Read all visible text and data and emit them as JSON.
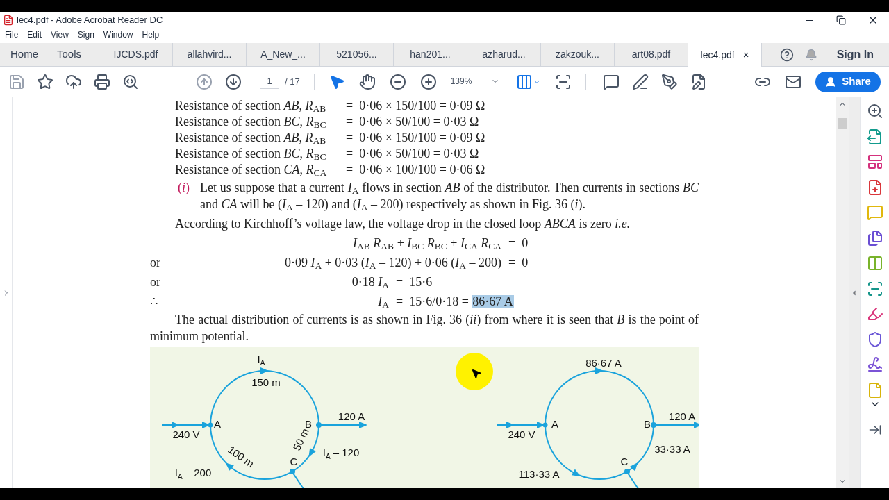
{
  "window": {
    "title": "lec4.pdf - Adobe Acrobat Reader DC"
  },
  "menu": [
    "File",
    "Edit",
    "View",
    "Sign",
    "Window",
    "Help"
  ],
  "nav_tabs": [
    "Home",
    "Tools"
  ],
  "doc_tabs": [
    {
      "label": "IJCDS.pdf",
      "selected": false
    },
    {
      "label": "allahvird...",
      "selected": false
    },
    {
      "label": "A_New_...",
      "selected": false
    },
    {
      "label": "521056...",
      "selected": false
    },
    {
      "label": "han201...",
      "selected": false
    },
    {
      "label": "azharud...",
      "selected": false
    },
    {
      "label": "zakzouk...",
      "selected": false
    },
    {
      "label": "art08.pdf",
      "selected": false
    },
    {
      "label": "lec4.pdf",
      "selected": true,
      "close": "×"
    }
  ],
  "sign_in": "Sign In",
  "toolbar": {
    "page": "1",
    "page_total": "/ 17",
    "zoom": "139%",
    "share": "Share",
    "tools": [
      {
        "kind": "select",
        "selected": true
      },
      {
        "kind": "hand",
        "selected": false
      }
    ]
  },
  "document": {
    "resistance_lines": [
      {
        "label": "Resistance of section *AB*, *R*$_{AB}$",
        "value": "=  0·06 × 150/100 = 0·09 Ω"
      },
      {
        "label": "Resistance of section *BC*, *R*$_{BC}$",
        "value": "=  0·06 × 50/100 = 0·03 Ω"
      },
      {
        "label": "Resistance of section *AB*, *R*$_{AB}$",
        "value": "=  0·06 × 150/100 = 0·09 Ω"
      },
      {
        "label": "Resistance of section *BC*, *R*$_{BC}$",
        "value": "=  0·06 × 50/100 = 0·03 Ω"
      },
      {
        "label": "Resistance of section *CA*, *R*$_{CA}$",
        "value": "=  0·06 × 100/100 = 0·06 Ω"
      }
    ],
    "item": {
      "marker": "(*i*)",
      "text": "Let us suppose that a current *I*$_{A}$ flows in section *AB* of the distributor.  Then currents in sections *BC* and *CA* will be (*I*$_{A}$ – 120) and (*I*$_{A}$ – 200) respectively as shown in Fig. 36 (*i*)."
    },
    "paragraph": "According to Kirchhoff’s voltage law, the voltage drop in the closed loop *ABCA* is zero *i.e.*",
    "equations": [
      {
        "lhs": "*I*$_{AB}$ *R*$_{AB}$ + *I*$_{BC}$ *R*$_{BC}$ + *I*$_{CA}$ *R*$_{CA}$",
        "rhs": "=  0"
      },
      {
        "prefix": "or",
        "lhs": "0·09 *I*$_{A}$ + 0·03 (*I*$_{A}$ – 120) + 0·06 (*I*$_{A}$ – 200)",
        "rhs": "=  0"
      },
      {
        "prefix": "or",
        "lhs": "0·18 *I*$_{A}$",
        "rhs": "=  15·6"
      },
      {
        "prefix": "∴",
        "lhs": "*I*$_{A}$",
        "rhs": "=  15·6/0·18 =",
        "highlighted": "86·67 A"
      }
    ],
    "conclusion": "The actual distribution of currents is as shown in Fig. 36 (*ii*) from where it is seen that *B* is the point of minimum potential.",
    "figure": {
      "left_labels": [
        {
          "text": "I",
          "sub": "A"
        },
        {
          "text": "150 m"
        },
        {
          "text": "A"
        },
        {
          "text": "240 V"
        },
        {
          "text": "B"
        },
        {
          "text": "120 A"
        },
        {
          "text": "50 m"
        },
        {
          "text": "I",
          "sub": "A",
          "rest": " – 120"
        },
        {
          "text": "100 m"
        },
        {
          "text": "C"
        },
        {
          "text": "I",
          "sub": "A",
          "rest": " – 200"
        }
      ],
      "right_labels": [
        {
          "text": "86·67 A"
        },
        {
          "text": "A"
        },
        {
          "text": "240 V"
        },
        {
          "text": "B"
        },
        {
          "text": "120 A"
        },
        {
          "text": "33·33 A"
        },
        {
          "text": "C"
        },
        {
          "text": "113·33 A"
        }
      ]
    }
  }
}
